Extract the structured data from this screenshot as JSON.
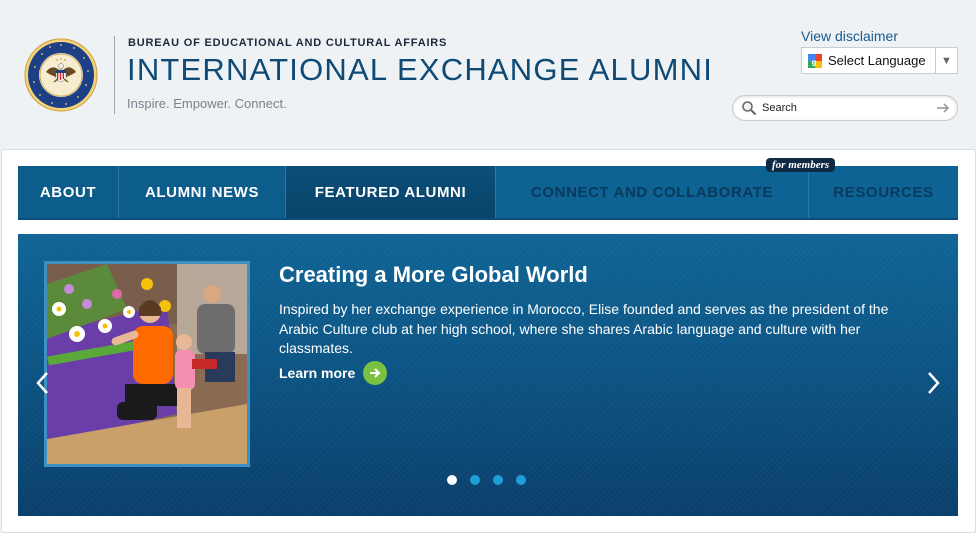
{
  "header": {
    "bureau": "BUREAU OF EDUCATIONAL AND CULTURAL AFFAIRS",
    "title": "INTERNATIONAL EXCHANGE ALUMNI",
    "tagline": "Inspire. Empower. Connect.",
    "seal_icon": "department-of-state-seal",
    "seal_text": "DEPARTMENT OF STATE · UNITED STATES OF AMERICA"
  },
  "utility": {
    "disclaimer": "View disclaimer",
    "language": "Select Language",
    "search_placeholder": "Search"
  },
  "nav": {
    "items": [
      {
        "label": "ABOUT"
      },
      {
        "label": "ALUMNI NEWS"
      },
      {
        "label": "FEATURED ALUMNI"
      },
      {
        "label": "CONNECT AND COLLABORATE"
      },
      {
        "label": "RESOURCES"
      }
    ],
    "active": "FEATURED ALUMNI",
    "badge": "for members"
  },
  "hero": {
    "title": "Creating a More Global World",
    "description": "Inspired by her exchange experience in Morocco, Elise founded and serves as the president of the Arabic Culture club at her high school, where she shares Arabic language and culture with her classmates.",
    "cta": "Learn more",
    "slides_total": 4,
    "active_slide": 1
  },
  "colors": {
    "brand_blue": "#0d5d8c",
    "title_blue": "#0f4a75",
    "cta_green": "#7ac142",
    "dot_blue": "#1f9fd8"
  }
}
